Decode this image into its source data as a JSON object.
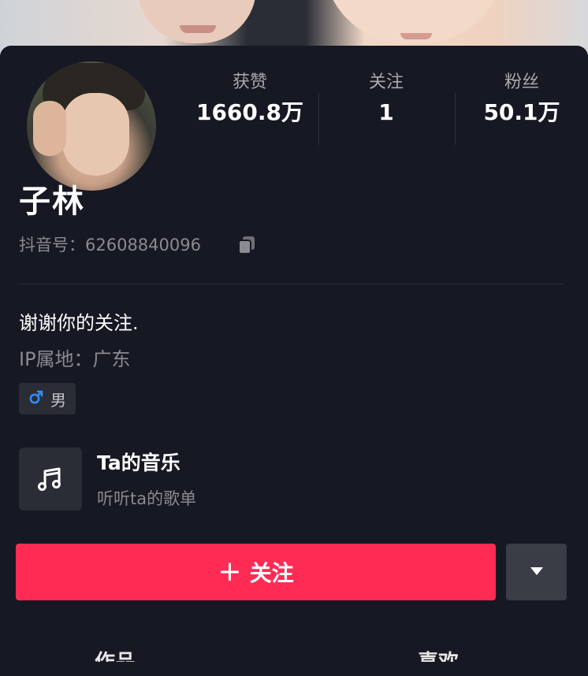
{
  "profile": {
    "name": "子林",
    "douyin_id": "抖音号：62608840096",
    "bio": "谢谢你的关注.",
    "ip_location": "IP属地：广东",
    "gender": "男"
  },
  "stats": [
    {
      "label": "获赞",
      "value": "1660.8万"
    },
    {
      "label": "关注",
      "value": "1"
    },
    {
      "label": "粉丝",
      "value": "50.1万"
    }
  ],
  "music": {
    "title": "Ta的音乐",
    "subtitle": "听听ta的歌单"
  },
  "actions": {
    "follow_icon": "+",
    "follow_label": "关注"
  },
  "tabs": [
    "作品",
    "喜欢"
  ],
  "icons": {
    "copy": "copy-icon",
    "gender": "male-icon",
    "music": "music-note-icon",
    "more": "triangle-down-icon"
  },
  "colors": {
    "background": "#161823",
    "accent": "#fe2c55",
    "male": "#2f8cf5"
  }
}
